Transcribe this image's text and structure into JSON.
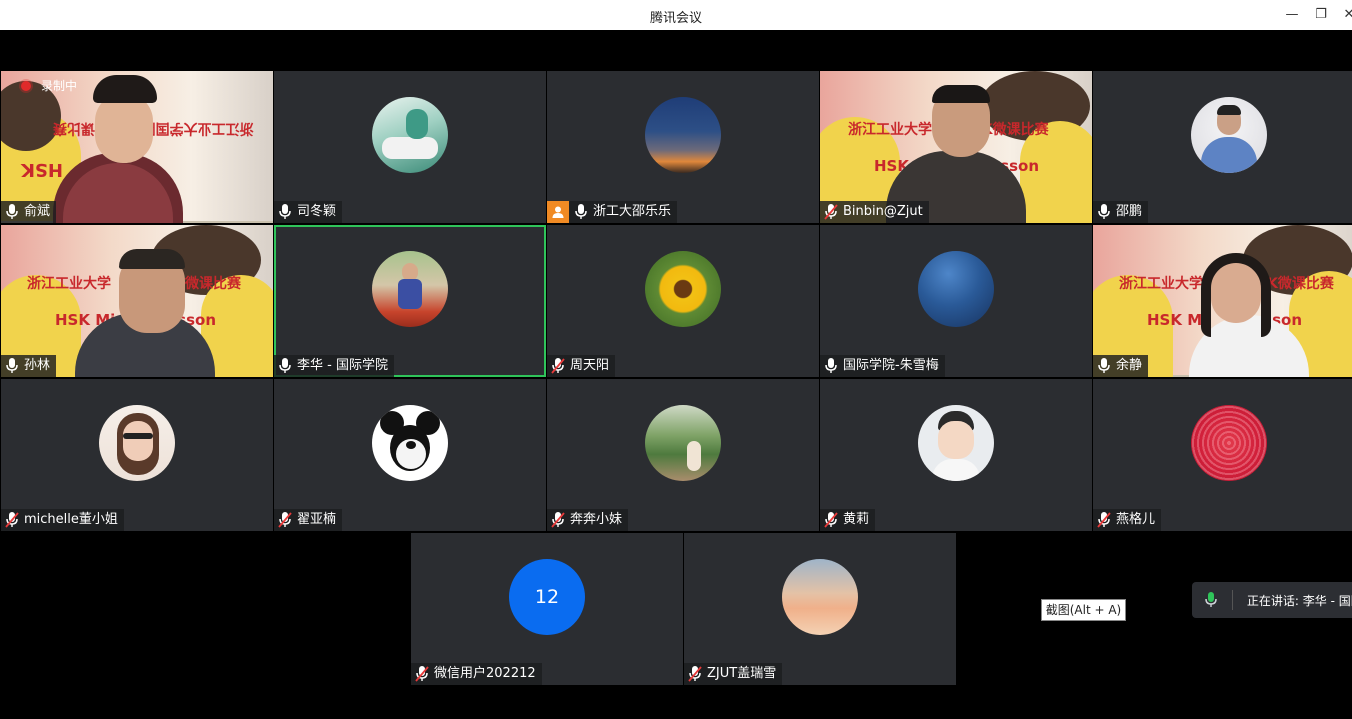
{
  "window": {
    "title": "腾讯会议",
    "minimize_icon": "minimize-icon",
    "restore_icon": "restore-icon"
  },
  "recording": {
    "label": "录制中"
  },
  "participants": [
    {
      "name": "俞斌",
      "mic": "on"
    },
    {
      "name": "司冬颖",
      "mic": "on"
    },
    {
      "name": "浙工大邵乐乐",
      "mic": "on",
      "badge": "person-icon"
    },
    {
      "name": "Binbin@Zjut",
      "mic": "muted"
    },
    {
      "name": "邵鹏",
      "mic": "on"
    },
    {
      "name": "孙林",
      "mic": "on"
    },
    {
      "name": "李华 - 国际学院",
      "mic": "on",
      "speaking": true
    },
    {
      "name": "周天阳",
      "mic": "muted"
    },
    {
      "name": "国际学院-朱雪梅",
      "mic": "on"
    },
    {
      "name": "余静",
      "mic": "on"
    },
    {
      "name": "michelle董小姐",
      "mic": "muted"
    },
    {
      "name": "翟亚楠",
      "mic": "muted"
    },
    {
      "name": "奔奔小妹",
      "mic": "muted"
    },
    {
      "name": "黄莉",
      "mic": "muted"
    },
    {
      "name": "燕格儿",
      "mic": "muted"
    },
    {
      "name": "微信用户202212",
      "mic": "muted",
      "avatar_text": "12"
    },
    {
      "name": "ZJUT盖瑞雪",
      "mic": "muted"
    }
  ],
  "poster": {
    "line1_mirrored": "浙江工业大学国际HSK微课比赛",
    "line1": "浙江工业大学国际HSK微课比赛",
    "line1_left": "浙江工业大学",
    "line1_left_b": "浙江工业大学",
    "line1_right": "微课比赛",
    "line1_right_b": "SK微课比赛",
    "line2_left": "HSK Mi",
    "line2_right": "esson",
    "line2_right_b": "esson",
    "line2": "HSK",
    "line2_b": "esson",
    "line2_left_b": "HSK M"
  },
  "tooltip": {
    "text": "截图(Alt + A)"
  },
  "speaking_panel": {
    "text": "正在讲话: 李华 - 国际"
  },
  "colors": {
    "speaking_border": "#2fc45a",
    "record_dot": "#e02a2a",
    "avatar_blue": "#0a6cf0",
    "tile_bg": "#2b2d31"
  }
}
